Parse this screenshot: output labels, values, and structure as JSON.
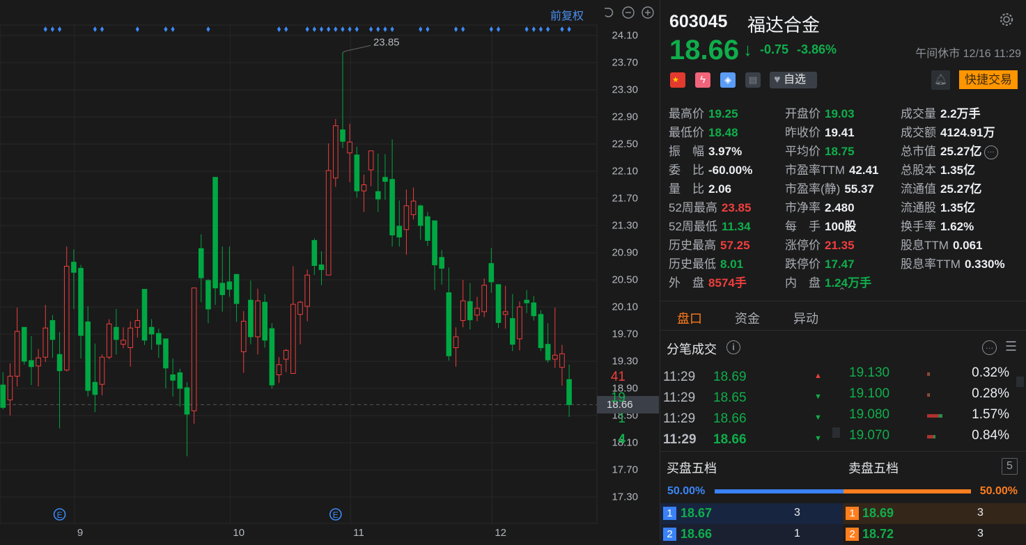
{
  "chart_toolbar": {
    "adjust_label": "前复权"
  },
  "chart_data": {
    "type": "candlestick",
    "ylim": [
      17.0,
      24.4
    ],
    "y_ticks": [
      "24.10",
      "23.70",
      "23.30",
      "22.90",
      "22.50",
      "22.10",
      "21.70",
      "21.30",
      "20.90",
      "20.50",
      "20.10",
      "19.70",
      "19.30",
      "18.90",
      "18.50",
      "18.10",
      "17.70",
      "17.30"
    ],
    "x_labels": [
      {
        "label": "9",
        "index": 10
      },
      {
        "label": "10",
        "index": 32
      },
      {
        "label": "11",
        "index": 49
      },
      {
        "label": "12",
        "index": 69
      }
    ],
    "ohlc": [
      [
        18.95,
        19.14,
        18.59,
        18.62
      ],
      [
        18.73,
        19.27,
        18.5,
        19.08
      ],
      [
        19.08,
        20.09,
        18.93,
        19.74
      ],
      [
        19.8,
        19.8,
        19.25,
        19.3
      ],
      [
        19.31,
        19.67,
        18.95,
        19.22
      ],
      [
        19.23,
        19.48,
        18.93,
        19.35
      ],
      [
        19.36,
        20.13,
        19.29,
        19.79
      ],
      [
        19.9,
        19.98,
        19.35,
        19.62
      ],
      [
        19.4,
        19.73,
        18.31,
        19.16
      ],
      [
        19.17,
        20.99,
        19.15,
        20.7
      ],
      [
        20.76,
        20.95,
        20.07,
        20.61
      ],
      [
        20.67,
        20.72,
        19.34,
        19.68
      ],
      [
        19.88,
        20.11,
        18.78,
        18.87
      ],
      [
        18.99,
        19.56,
        18.55,
        18.81
      ],
      [
        18.96,
        19.4,
        18.8,
        19.36
      ],
      [
        19.36,
        19.92,
        19.33,
        19.85
      ],
      [
        19.8,
        20.07,
        19.4,
        19.62
      ],
      [
        19.55,
        19.8,
        19.49,
        19.61
      ],
      [
        19.5,
        19.89,
        19.22,
        19.79
      ],
      [
        19.8,
        20.07,
        19.65,
        19.9
      ],
      [
        20.36,
        20.36,
        19.54,
        19.61
      ],
      [
        19.8,
        19.92,
        19.47,
        19.7
      ],
      [
        19.71,
        19.78,
        19.35,
        19.55
      ],
      [
        19.63,
        19.63,
        18.9,
        19.2
      ],
      [
        19.1,
        19.34,
        18.78,
        19.02
      ],
      [
        19.13,
        19.19,
        18.63,
        18.9
      ],
      [
        18.91,
        18.99,
        17.9,
        18.52
      ],
      [
        18.57,
        20.38,
        18.38,
        20.38
      ],
      [
        20.96,
        21.17,
        20.17,
        20.53
      ],
      [
        20.49,
        20.51,
        19.86,
        20.07
      ],
      [
        22.01,
        22.01,
        20.13,
        20.38
      ],
      [
        20.45,
        20.99,
        20.03,
        20.28
      ],
      [
        20.47,
        20.99,
        20.25,
        20.36
      ],
      [
        20.58,
        20.58,
        19.88,
        20.15
      ],
      [
        19.44,
        20.04,
        19.13,
        19.89
      ],
      [
        20.2,
        20.49,
        19.55,
        19.66
      ],
      [
        19.66,
        20.37,
        19.4,
        20.19
      ],
      [
        20.17,
        20.29,
        19.5,
        19.61
      ],
      [
        19.78,
        19.86,
        18.9,
        18.95
      ],
      [
        19.1,
        19.36,
        18.98,
        19.25
      ],
      [
        19.33,
        19.48,
        19.14,
        19.46
      ],
      [
        19.12,
        20.7,
        19.12,
        20.14
      ],
      [
        19.99,
        20.19,
        19.55,
        20.17
      ],
      [
        20.11,
        20.65,
        19.89,
        20.57
      ],
      [
        21.08,
        21.11,
        20.57,
        20.71
      ],
      [
        20.72,
        20.92,
        20.42,
        20.65
      ],
      [
        20.57,
        22.51,
        20.57,
        22.11
      ],
      [
        22.0,
        22.87,
        21.87,
        22.77
      ],
      [
        22.71,
        23.85,
        22.44,
        22.54
      ],
      [
        22.37,
        22.8,
        21.94,
        22.53
      ],
      [
        22.34,
        22.46,
        21.71,
        21.81
      ],
      [
        21.81,
        22.05,
        21.5,
        21.9
      ],
      [
        22.12,
        22.4,
        21.88,
        22.4
      ],
      [
        21.8,
        22.36,
        21.5,
        21.69
      ],
      [
        22.01,
        22.35,
        21.68,
        21.95
      ],
      [
        21.98,
        22.57,
        20.99,
        21.16
      ],
      [
        21.29,
        21.67,
        20.99,
        21.13
      ],
      [
        21.24,
        21.83,
        20.87,
        21.59
      ],
      [
        21.46,
        21.86,
        21.39,
        21.66
      ],
      [
        21.59,
        21.61,
        21.09,
        21.3
      ],
      [
        21.43,
        21.5,
        21.0,
        21.08
      ],
      [
        21.37,
        21.37,
        20.35,
        20.72
      ],
      [
        20.83,
        20.94,
        20.43,
        20.67
      ],
      [
        20.31,
        20.68,
        19.31,
        19.38
      ],
      [
        19.5,
        19.8,
        19.22,
        19.66
      ],
      [
        19.9,
        20.5,
        19.8,
        20.19
      ],
      [
        20.18,
        20.45,
        19.77,
        19.91
      ],
      [
        19.98,
        20.25,
        19.89,
        20.08
      ],
      [
        20.03,
        20.52,
        19.95,
        20.42
      ],
      [
        20.74,
        20.97,
        20.31,
        20.47
      ],
      [
        20.43,
        20.43,
        19.79,
        19.87
      ],
      [
        19.99,
        20.41,
        19.78,
        20.03
      ],
      [
        19.93,
        20.29,
        19.45,
        19.55
      ],
      [
        19.63,
        20.18,
        19.46,
        20.1
      ],
      [
        20.2,
        20.35,
        20.01,
        20.16
      ],
      [
        20.16,
        20.26,
        19.9,
        19.97
      ],
      [
        19.99,
        20.05,
        19.45,
        19.5
      ],
      [
        19.55,
        19.86,
        19.28,
        19.32
      ],
      [
        19.33,
        20.09,
        19.2,
        19.39
      ],
      [
        19.21,
        19.54,
        18.94,
        19.41
      ],
      [
        19.03,
        19.25,
        18.48,
        18.66
      ]
    ],
    "signal_markers": [
      6,
      7,
      8,
      13,
      14,
      19,
      23,
      24,
      29,
      39,
      40,
      43,
      44,
      45,
      46,
      47,
      48,
      49,
      50,
      52,
      53,
      54,
      55,
      59,
      60,
      64,
      65,
      69,
      70,
      74,
      75,
      76,
      77,
      79,
      80
    ],
    "event_markers": [
      {
        "index": 8,
        "label": "E"
      },
      {
        "index": 47,
        "label": "E"
      }
    ],
    "high_annotation": {
      "index": 48,
      "label": "23.85",
      "value": 23.85
    },
    "last_price": {
      "label": "18.66",
      "value": 18.66
    },
    "colors": {
      "up": "#f03e3e",
      "down": "#00a843",
      "marker": "#3d8af7"
    }
  },
  "quote": {
    "code": "603045",
    "name": "福达合金",
    "price": "18.66",
    "change": "-0.75",
    "change_pct": "-3.86%",
    "status": "午间休市 12/16 11:29",
    "watch_label": "自选",
    "trade_label": "快捷交易"
  },
  "stats": [
    {
      "label": "最高价",
      "value": "19.25",
      "tone": "green"
    },
    {
      "label": "开盘价",
      "value": "19.03",
      "tone": "green"
    },
    {
      "label": "成交量",
      "value": "2.2万手",
      "tone": "white"
    },
    {
      "label": "最低价",
      "value": "18.48",
      "tone": "green"
    },
    {
      "label": "昨收价",
      "value": "19.41",
      "tone": "white"
    },
    {
      "label": "成交额",
      "value": "4124.91万",
      "tone": "white"
    },
    {
      "label": "振　幅",
      "value": "3.97%",
      "tone": "white"
    },
    {
      "label": "平均价",
      "value": "18.75",
      "tone": "green"
    },
    {
      "label": "总市值",
      "value": "25.27亿",
      "tone": "white"
    },
    {
      "label": "委　比",
      "value": "-60.00%",
      "tone": "white"
    },
    {
      "label": "市盈率TTM",
      "value": "42.41",
      "tone": "white"
    },
    {
      "label": "总股本",
      "value": "1.35亿",
      "tone": "white"
    },
    {
      "label": "量　比",
      "value": "2.06",
      "tone": "white"
    },
    {
      "label": "市盈率(静)",
      "value": "55.37",
      "tone": "white"
    },
    {
      "label": "流通值",
      "value": "25.27亿",
      "tone": "white"
    },
    {
      "label": "52周最高",
      "value": "23.85",
      "tone": "red"
    },
    {
      "label": "市净率",
      "value": "2.480",
      "tone": "white"
    },
    {
      "label": "流通股",
      "value": "1.35亿",
      "tone": "white"
    },
    {
      "label": "52周最低",
      "value": "11.34",
      "tone": "green"
    },
    {
      "label": "每　手",
      "value": "100股",
      "tone": "white"
    },
    {
      "label": "换手率",
      "value": "1.62%",
      "tone": "white"
    },
    {
      "label": "历史最高",
      "value": "57.25",
      "tone": "red"
    },
    {
      "label": "涨停价",
      "value": "21.35",
      "tone": "red"
    },
    {
      "label": "股息TTM",
      "value": "0.061",
      "tone": "white"
    },
    {
      "label": "历史最低",
      "value": "8.01",
      "tone": "green"
    },
    {
      "label": "跌停价",
      "value": "17.47",
      "tone": "green"
    },
    {
      "label": "股息率TTM",
      "value": "0.330%",
      "tone": "white"
    },
    {
      "label": "外　盘",
      "value": "8574手",
      "tone": "red"
    },
    {
      "label": "内　盘",
      "value": "1.24万手",
      "tone": "green"
    }
  ],
  "tabs": [
    {
      "label": "盘口",
      "active": true
    },
    {
      "label": "资金"
    },
    {
      "label": "异动"
    }
  ],
  "ticks": {
    "title": "分笔成交",
    "rows": [
      {
        "time": "11:29",
        "price": "18.69",
        "vol": "41",
        "dir": "up"
      },
      {
        "time": "11:29",
        "price": "18.65",
        "vol": "19",
        "dir": "down"
      },
      {
        "time": "11:29",
        "price": "18.66",
        "vol": "1",
        "dir": "down"
      },
      {
        "time": "11:29",
        "price": "18.66",
        "vol": "4",
        "dir": "down"
      }
    ],
    "levels": [
      {
        "price": "19.130",
        "pct": "0.32%",
        "share": 0.32
      },
      {
        "price": "19.100",
        "pct": "0.28%",
        "share": 0.28
      },
      {
        "price": "19.080",
        "pct": "1.57%",
        "share": 1.57
      },
      {
        "price": "19.070",
        "pct": "0.84%",
        "share": 0.84
      }
    ]
  },
  "orderbook": {
    "buy_title": "买盘五档",
    "sell_title": "卖盘五档",
    "depth_label": "5",
    "buy_ratio": "50.00%",
    "sell_ratio": "50.00%",
    "rows": [
      {
        "bid_no": "1",
        "bid": "18.67",
        "bid_vol": "3",
        "ask_no": "1",
        "ask": "18.69",
        "ask_vol": "3"
      },
      {
        "bid_no": "2",
        "bid": "18.66",
        "bid_vol": "1",
        "ask_no": "2",
        "ask": "18.72",
        "ask_vol": "3"
      }
    ]
  }
}
